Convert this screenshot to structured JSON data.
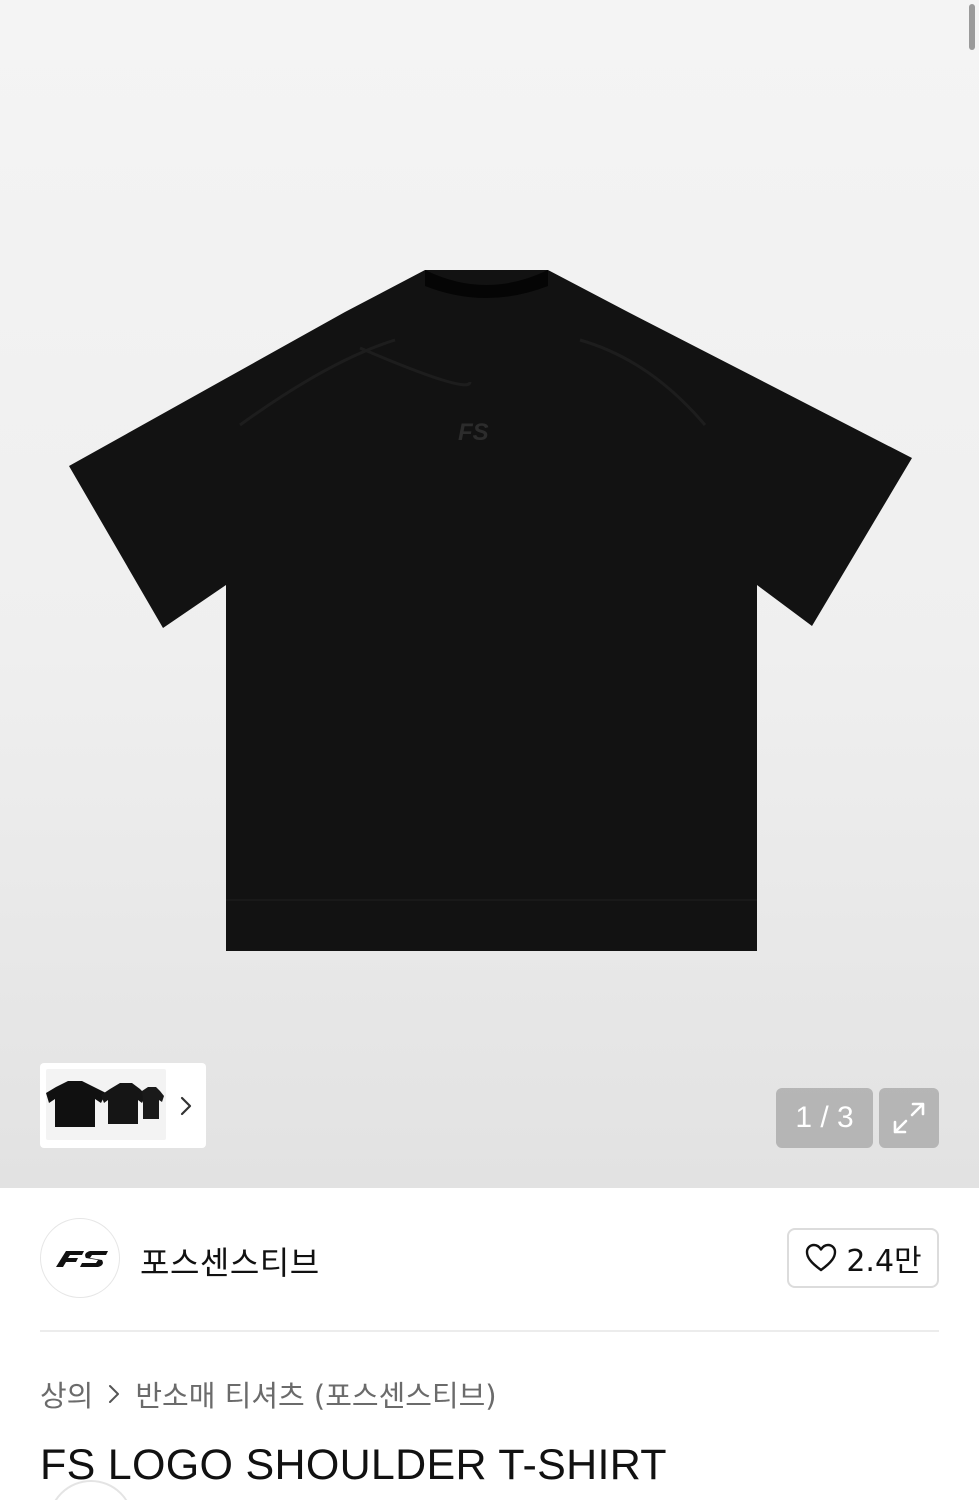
{
  "gallery": {
    "counter": "1 / 3",
    "current_image": 1,
    "total_images": 3,
    "logo_text": "FS",
    "background": "#f0f0f0"
  },
  "icons": {
    "thumb_next": "chevron-right-icon",
    "expand": "expand-icon",
    "like": "heart-icon",
    "breadcrumb_separator": "chevron-right-icon"
  },
  "brand": {
    "name": "포스센스티브",
    "logo_text": "FS",
    "like_count": "2.4만"
  },
  "breadcrumb": {
    "items": [
      "상의",
      "반소매 티셔츠 (포스센스티브)"
    ]
  },
  "product": {
    "title": "FS LOGO SHOULDER T-SHIRT"
  },
  "colors": {
    "text": "#111111",
    "muted": "#6b6b6b",
    "border": "#dcdcdc",
    "overlay": "#969696"
  }
}
